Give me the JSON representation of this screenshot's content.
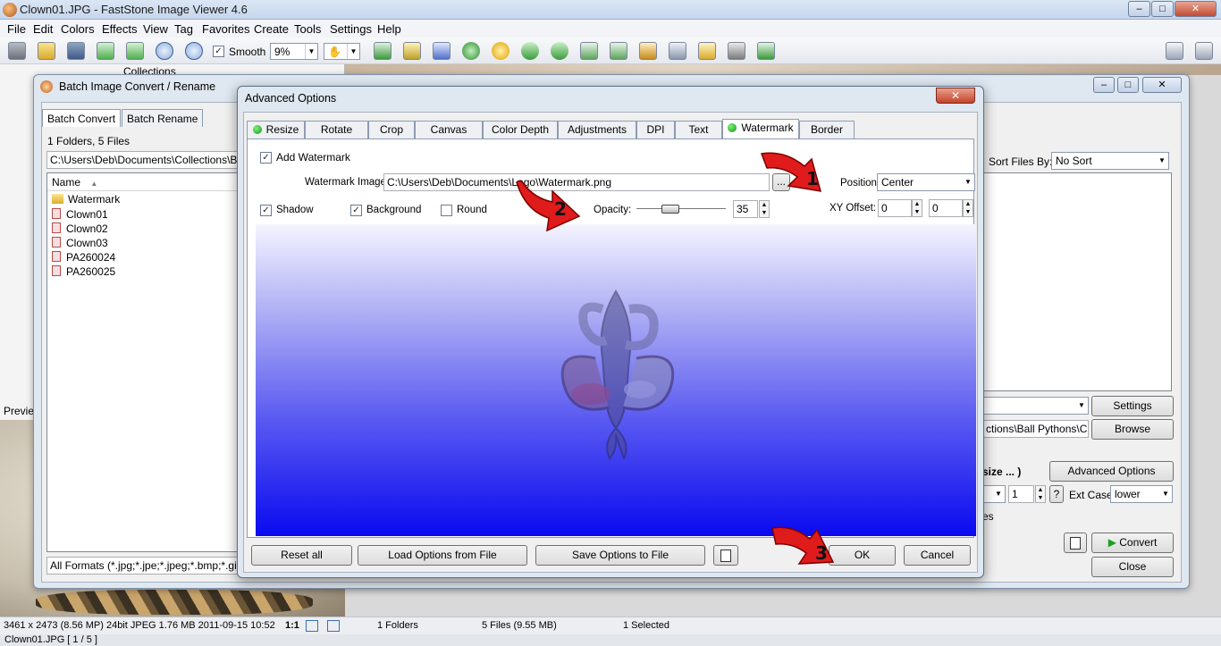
{
  "window": {
    "title": "Clown01.JPG  -  FastStone Image Viewer 4.6",
    "min": "–",
    "max": "□",
    "close": "✕"
  },
  "menu": [
    "File",
    "Edit",
    "Colors",
    "Effects",
    "View",
    "Tag",
    "Favorites",
    "Create",
    "Tools",
    "Settings",
    "Help"
  ],
  "toolbar": {
    "smooth_label": "Smooth",
    "smooth_checked": "✓",
    "zoom_value": "9%"
  },
  "browser": {
    "collections_label": "Collections",
    "preview_label": "Previe"
  },
  "batch": {
    "title": "Batch Image Convert / Rename",
    "tabs": [
      "Batch Convert",
      "Batch Rename"
    ],
    "summary": "1 Folders, 5 Files",
    "path": "C:\\Users\\Deb\\Documents\\Collections\\Ball Py",
    "column_name": "Name",
    "files": [
      "Watermark",
      "Clown01",
      "Clown02",
      "Clown03",
      "PA260024",
      "PA260025"
    ],
    "filter": "All Formats (*.jpg;*.jpe;*.jpeg;*.bmp;*.gif",
    "sort_label": "Sort Files By:",
    "sort_value": "No Sort",
    "settings_button": "Settings",
    "output_path": "ctions\\Ball Pythons\\Clov",
    "browse_button": "Browse",
    "resize_label": "size ... )",
    "advanced_button": "Advanced Options",
    "start_number": "1",
    "help": "?",
    "ext_case_label": "Ext Case:",
    "ext_case_value": "lower",
    "partial_label": "es",
    "convert_button": "Convert",
    "close_button": "Close"
  },
  "advanced": {
    "title": "Advanced Options",
    "close": "✕",
    "tabs": [
      "Resize",
      "Rotate",
      "Crop",
      "Canvas",
      "Color Depth",
      "Adjustments",
      "DPI",
      "Text",
      "Watermark",
      "Border"
    ],
    "add_watermark_label": "Add Watermark",
    "add_watermark_checked": "✓",
    "watermark_image_label": "Watermark Image:",
    "watermark_image_path": "C:\\Users\\Deb\\Documents\\Logo\\Watermark.png",
    "browse_dots": "...",
    "position_label": "Position:",
    "position_value": "Center",
    "shadow_label": "Shadow",
    "shadow_checked": "✓",
    "background_label": "Background",
    "background_checked": "✓",
    "round_label": "Round",
    "round_checked": "",
    "opacity_label": "Opacity:",
    "opacity_value": "35",
    "xy_offset_label": "XY Offset:",
    "x_offset": "0",
    "y_offset": "0",
    "reset_button": "Reset all",
    "load_button": "Load Options from File",
    "save_button": "Save Options to File",
    "ok_button": "OK",
    "cancel_button": "Cancel"
  },
  "annotations": [
    "1",
    "2",
    "3"
  ],
  "status": {
    "image_info": "3461 x 2473 (8.56 MP)  24bit  JPEG   1.76 MB   2011-09-15 10:52",
    "ratio": "1:1",
    "folders": "1 Folders",
    "files": "5 Files (9.55 MB)",
    "selected": "1 Selected",
    "filename": "Clown01.JPG [ 1 / 5 ]"
  }
}
